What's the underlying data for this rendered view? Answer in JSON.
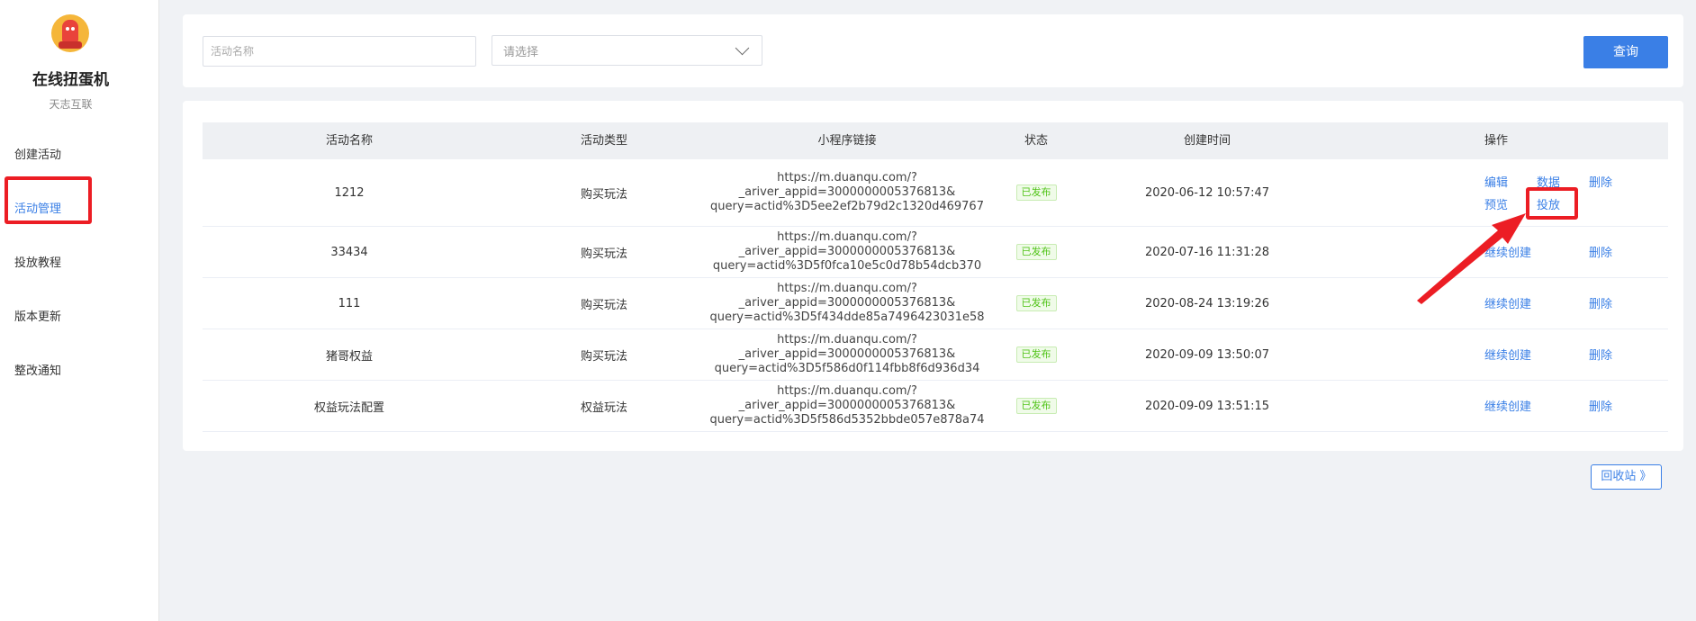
{
  "sidebar": {
    "brand_title": "在线扭蛋机",
    "brand_subtitle": "天志互联",
    "items": [
      {
        "label": "创建活动"
      },
      {
        "label": "活动管理",
        "active": true
      },
      {
        "label": "投放教程"
      },
      {
        "label": "版本更新"
      },
      {
        "label": "整改通知"
      }
    ]
  },
  "search": {
    "name_placeholder": "活动名称",
    "select_placeholder": "请选择",
    "query_label": "查询"
  },
  "table": {
    "columns": [
      "活动名称",
      "活动类型",
      "小程序链接",
      "状态",
      "创建时间",
      "操作"
    ],
    "rows": [
      {
        "name": "1212",
        "type": "购买玩法",
        "link1": "https://m.duanqu.com/?_ariver_appid=3000000005376813&",
        "link2": "query=actid%3D5ee2ef2b79d2c1320d469767",
        "status": "已发布",
        "created": "2020-06-12 10:57:47"
      },
      {
        "name": "33434",
        "type": "购买玩法",
        "link1": "https://m.duanqu.com/?_ariver_appid=3000000005376813&",
        "link2": "query=actid%3D5f0fca10e5c0d78b54dcb370",
        "status": "已发布",
        "created": "2020-07-16 11:31:28",
        "op1": "继续创建",
        "op2": "删除"
      },
      {
        "name": "111",
        "type": "购买玩法",
        "link1": "https://m.duanqu.com/?_ariver_appid=3000000005376813&",
        "link2": "query=actid%3D5f434dde85a7496423031e58",
        "status": "已发布",
        "created": "2020-08-24 13:19:26",
        "op1": "继续创建",
        "op2": "删除"
      },
      {
        "name": "猪哥权益",
        "type": "购买玩法",
        "link1": "https://m.duanqu.com/?_ariver_appid=3000000005376813&",
        "link2": "query=actid%3D5f586d0f114fbb8f6d936d34",
        "status": "已发布",
        "created": "2020-09-09 13:50:07",
        "op1": "继续创建",
        "op2": "删除"
      },
      {
        "name": "权益玩法配置",
        "type": "权益玩法",
        "link1": "https://m.duanqu.com/?_ariver_appid=3000000005376813&",
        "link2": "query=actid%3D5f586d5352bbde057e878a74",
        "status": "已发布",
        "created": "2020-09-09 13:51:15",
        "op1": "继续创建",
        "op2": "删除"
      }
    ],
    "first_row_ops": {
      "edit": "编辑",
      "data": "数据",
      "delete": "删除",
      "preview": "预览",
      "launch": "投放"
    }
  },
  "recycle_label": "回收站 》",
  "colors": {
    "accent": "#3a7fe6",
    "highlight": "#ec1d24",
    "published": "#52c41a"
  }
}
